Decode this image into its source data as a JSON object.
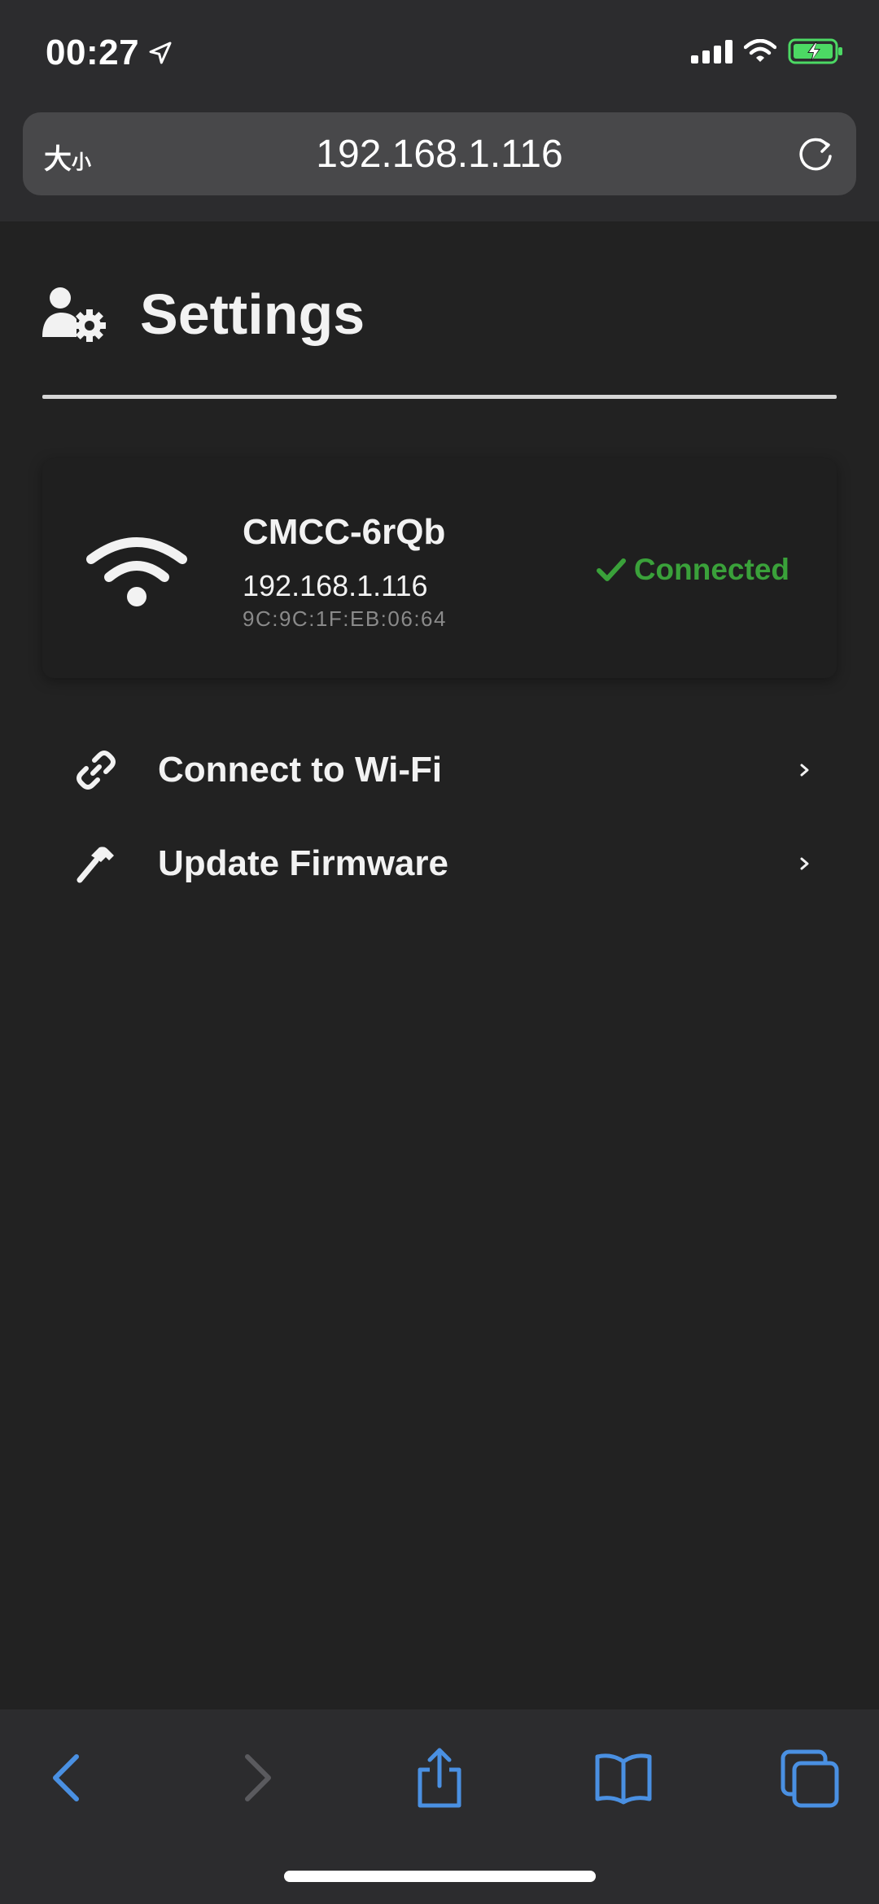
{
  "status_bar": {
    "time": "00:27",
    "icons": [
      "location-arrow-icon",
      "signal-icon",
      "wifi-icon",
      "battery-charging-icon"
    ],
    "battery_color": "#4cd964"
  },
  "browser": {
    "text_size_label": "大",
    "text_size_small": "小",
    "url": "192.168.1.116",
    "reload_icon": "reload-icon"
  },
  "page": {
    "title": "Settings",
    "title_icon": "user-cog-icon"
  },
  "network": {
    "ssid": "CMCC-6rQb",
    "ip": "192.168.1.116",
    "mac": "9C:9C:1F:EB:06:64",
    "status": "Connected",
    "status_color": "#3aa13a",
    "icon": "wifi-icon"
  },
  "menu": [
    {
      "label": "Connect to Wi-Fi",
      "icon": "link-icon"
    },
    {
      "label": "Update Firmware",
      "icon": "hammer-icon"
    }
  ],
  "toolbar": {
    "accent": "#4a90e2",
    "items": [
      "back-icon",
      "forward-icon",
      "share-icon",
      "bookmarks-icon",
      "tabs-icon"
    ]
  }
}
